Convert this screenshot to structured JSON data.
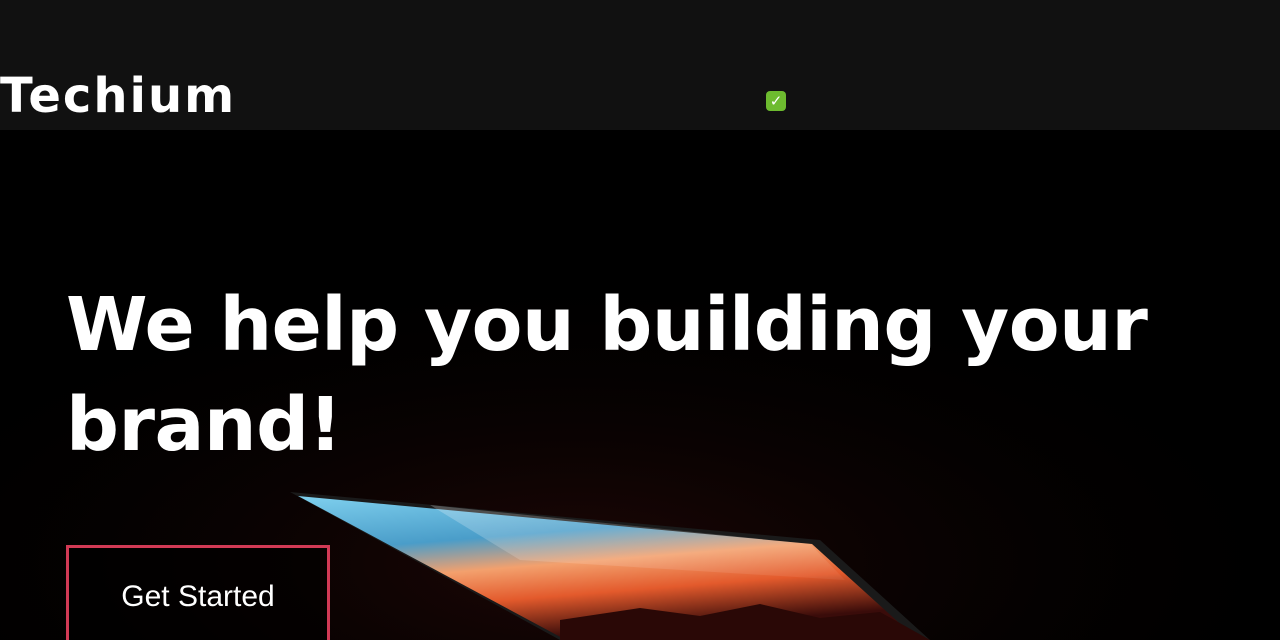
{
  "header": {
    "logo_text": "Techium",
    "status_icon": "check-mark-icon",
    "status_glyph": "✓"
  },
  "hero": {
    "headline": "We help you building your brand!",
    "cta_label": "Get Started",
    "image": "laptop-photo"
  },
  "colors": {
    "topbar_bg": "#111111",
    "hero_bg": "#000000",
    "text": "#ffffff",
    "cta_border": "#d23a55",
    "badge": "#6dbb2f"
  }
}
